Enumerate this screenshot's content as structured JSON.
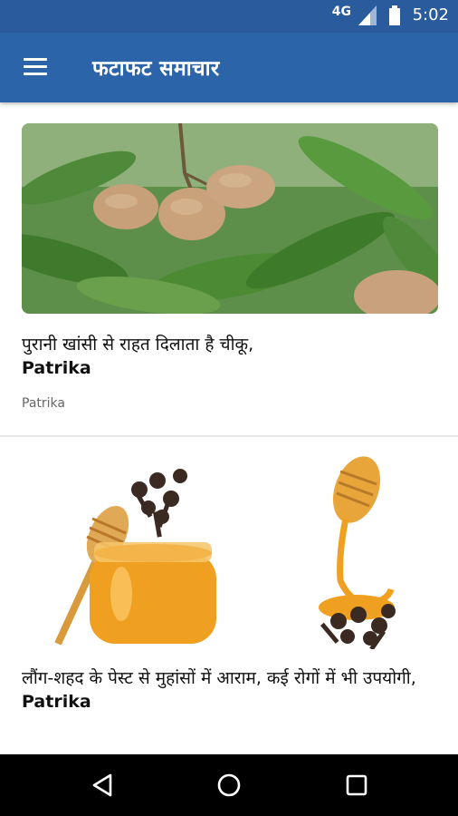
{
  "status_bar": {
    "network": "4G",
    "time": "5:02",
    "icons": [
      "signal-icon",
      "battery-icon"
    ]
  },
  "app_bar": {
    "title": "फटाफट समाचार",
    "menu_icon": "menu-icon"
  },
  "articles": [
    {
      "title": "पुरानी खांसी से राहत दिलाता है चीकू,",
      "source_bold": "Patrika",
      "source": "Patrika",
      "image": "sapodilla-fruits-on-tree"
    },
    {
      "title": "लौंग-शहद के पेस्ट से मुहांसों में आराम, कई रोगों में भी उपयोगी,",
      "source_bold": "Patrika",
      "image": "honey-jar-and-cloves"
    }
  ],
  "nav_bar": {
    "icons": [
      "back-icon",
      "home-icon",
      "recents-icon"
    ]
  },
  "colors": {
    "status_bar": "#2a5b9d",
    "app_bar": "#2c64aa"
  }
}
